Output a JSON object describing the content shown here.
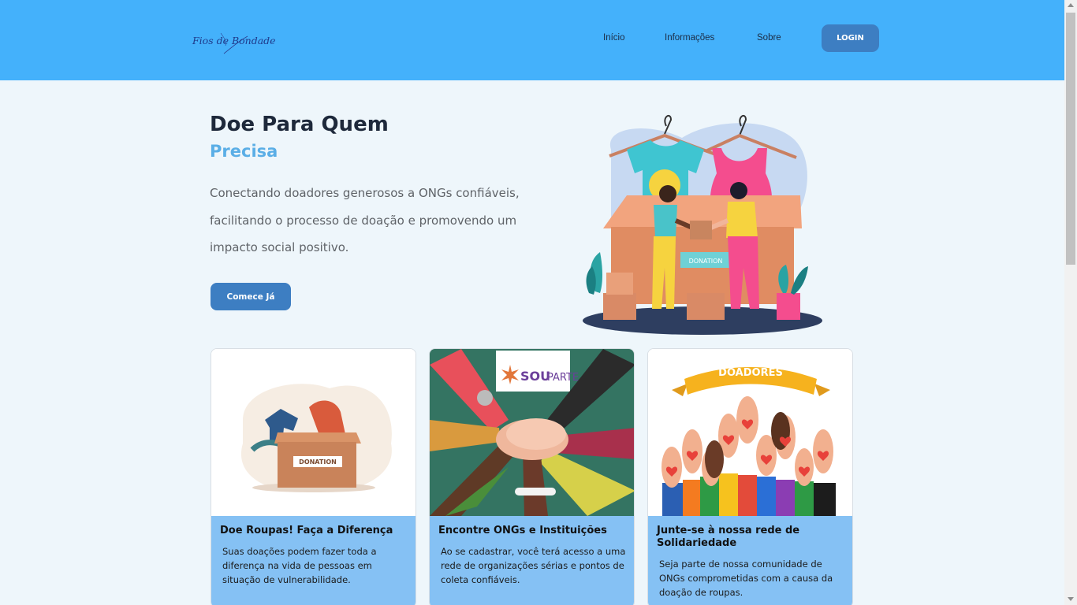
{
  "brand": {
    "logo_text": "Fios de Bondade"
  },
  "nav": {
    "items": [
      {
        "label": "Início"
      },
      {
        "label": "Informações"
      },
      {
        "label": "Sobre"
      }
    ],
    "login_label": "LOGIN"
  },
  "hero": {
    "title": "Doe Para Quem",
    "accent": "Precisa",
    "description": "Conectando doadores generosos a ONGs confiáveis, facilitando o processo de doação e promovendo um impacto social positivo.",
    "cta_label": "Comece Já",
    "illustration_label": "DONATION"
  },
  "cards": [
    {
      "title": "Doe Roupas! Faça a Diferença",
      "text": "Suas doações podem fazer toda a diferença na vida de pessoas em situação de vulnerabilidade.",
      "image_label": "DONATION"
    },
    {
      "title": "Encontre ONGs e Instituições",
      "text": "Ao se cadastrar, você terá acesso a uma rede de organizações sérias e pontos de coleta confiáveis.",
      "image_label_bold": "SOU",
      "image_label_light": "PARTE"
    },
    {
      "title": "Junte-se à nossa rede de Solidariedade",
      "text": "Seja parte de nossa comunidade de ONGs comprometidas com a causa da doação de roupas.",
      "image_label": "DOADORES"
    }
  ],
  "colors": {
    "header": "#44b1fb",
    "primary_button": "#3d7ec2",
    "accent_text": "#5aaee6",
    "card_body": "#85c1f4",
    "page_bg": "#eef6fb"
  }
}
